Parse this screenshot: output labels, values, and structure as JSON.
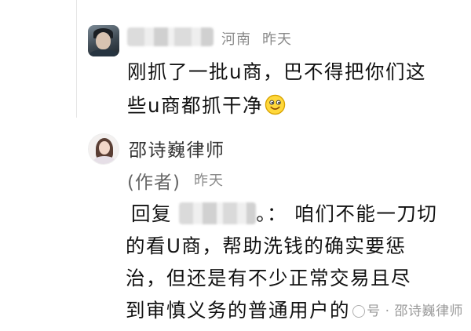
{
  "comment": {
    "location": "河南",
    "time": "昨天",
    "text_line1": "刚抓了一批u商，巴不得把你们这",
    "text_line2": "些u商都抓干净"
  },
  "reply": {
    "author_name": "邵诗巍律师",
    "author_tag": "(作者)",
    "time": "昨天",
    "reply_prefix": "回复",
    "reply_suffix": "。：",
    "line1_rest": " 咱们不能一刀切",
    "line2": "的看U商，帮助洗钱的确实要惩",
    "line3": "治，但还是有不少正常交易且尽",
    "line4": "到审慎义务的普通用户的"
  },
  "watermark": {
    "label": "号 · 邵诗巍律师"
  }
}
